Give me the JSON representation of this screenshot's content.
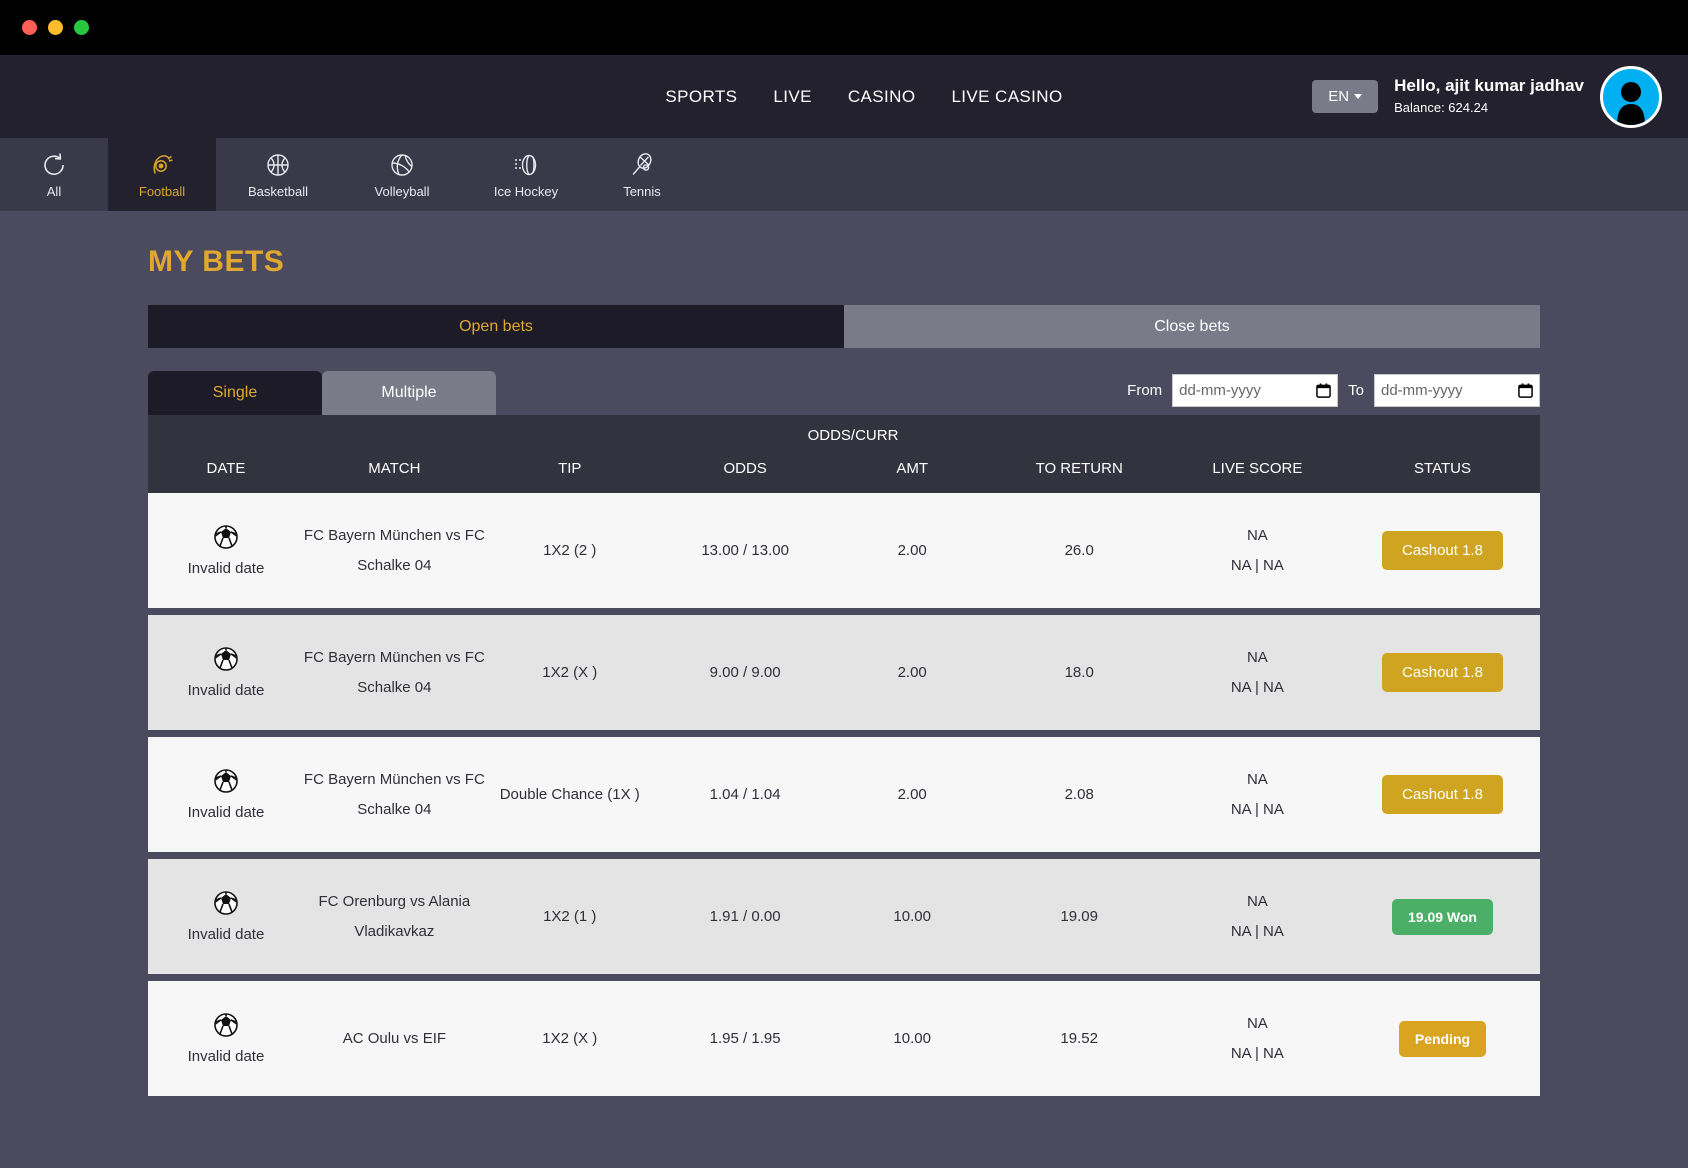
{
  "window": {
    "traffic_lights": [
      "close",
      "minimize",
      "maximize"
    ]
  },
  "header": {
    "nav": [
      {
        "label": "SPORTS",
        "name": "nav-sports"
      },
      {
        "label": "LIVE",
        "name": "nav-live"
      },
      {
        "label": "CASINO",
        "name": "nav-casino"
      },
      {
        "label": "LIVE CASINO",
        "name": "nav-live-casino"
      }
    ],
    "language": "EN",
    "greeting": "Hello, ajit kumar jadhav",
    "balance": "Balance: 624.24"
  },
  "sports_nav": {
    "items": [
      {
        "label": "All",
        "icon": "refresh-icon",
        "active": false
      },
      {
        "label": "Football",
        "icon": "football-icon",
        "active": true
      },
      {
        "label": "Basketball",
        "icon": "basketball-icon",
        "active": false
      },
      {
        "label": "Volleyball",
        "icon": "volleyball-icon",
        "active": false
      },
      {
        "label": "Ice Hockey",
        "icon": "ice-hockey-icon",
        "active": false
      },
      {
        "label": "Tennis",
        "icon": "tennis-icon",
        "active": false
      }
    ]
  },
  "page": {
    "title": "MY BETS",
    "bets_toggle": {
      "open_label": "Open bets",
      "close_label": "Close bets",
      "active": "open"
    },
    "type_tabs": {
      "single_label": "Single",
      "multiple_label": "Multiple",
      "active": "single"
    },
    "date_filter": {
      "from_label": "From",
      "from_value": "",
      "from_placeholder": "dd-mm-yyyy",
      "to_label": "To",
      "to_value": "",
      "to_placeholder": "dd-mm-yyyy"
    }
  },
  "table": {
    "group_header": "ODDS/CURR",
    "columns": [
      "DATE",
      "MATCH",
      "TIP",
      "ODDS",
      "AMT",
      "TO RETURN",
      "LIVE SCORE",
      "STATUS"
    ],
    "rows": [
      {
        "date": "Invalid date",
        "sport_icon": "football-ball-icon",
        "match": "FC Bayern München vs FC Schalke 04",
        "tip": "1X2 (2 )",
        "odds": "13.00 / 13.00",
        "amt": "2.00",
        "to_return": "26.0",
        "live_score_top": "NA",
        "live_score_bottom": "NA | NA",
        "status_label": "Cashout 1.8",
        "status_type": "cashout"
      },
      {
        "date": "Invalid date",
        "sport_icon": "football-ball-icon",
        "match": "FC Bayern München vs FC Schalke 04",
        "tip": "1X2 (X )",
        "odds": "9.00 / 9.00",
        "amt": "2.00",
        "to_return": "18.0",
        "live_score_top": "NA",
        "live_score_bottom": "NA | NA",
        "status_label": "Cashout 1.8",
        "status_type": "cashout"
      },
      {
        "date": "Invalid date",
        "sport_icon": "football-ball-icon",
        "match": "FC Bayern München vs FC Schalke 04",
        "tip": "Double Chance (1X )",
        "odds": "1.04 / 1.04",
        "amt": "2.00",
        "to_return": "2.08",
        "live_score_top": "NA",
        "live_score_bottom": "NA | NA",
        "status_label": "Cashout 1.8",
        "status_type": "cashout"
      },
      {
        "date": "Invalid date",
        "sport_icon": "football-ball-icon",
        "match": "FC Orenburg vs Alania Vladikavkaz",
        "tip": "1X2 (1 )",
        "odds": "1.91 / 0.00",
        "amt": "10.00",
        "to_return": "19.09",
        "live_score_top": "NA",
        "live_score_bottom": "NA | NA",
        "status_label": "19.09 Won",
        "status_type": "won"
      },
      {
        "date": "Invalid date",
        "sport_icon": "football-ball-icon",
        "match": "AC Oulu vs EIF",
        "tip": "1X2 (X )",
        "odds": "1.95 / 1.95",
        "amt": "10.00",
        "to_return": "19.52",
        "live_score_top": "NA",
        "live_score_bottom": "NA | NA",
        "status_label": "Pending",
        "status_type": "pending"
      }
    ]
  },
  "colors": {
    "accent_gold": "#e0a82e",
    "cashout": "#cfa420",
    "won_green": "#4caf67",
    "pending_gold": "#d9a420",
    "header_dark": "#23212e",
    "page_bg": "#4b4a5e"
  }
}
